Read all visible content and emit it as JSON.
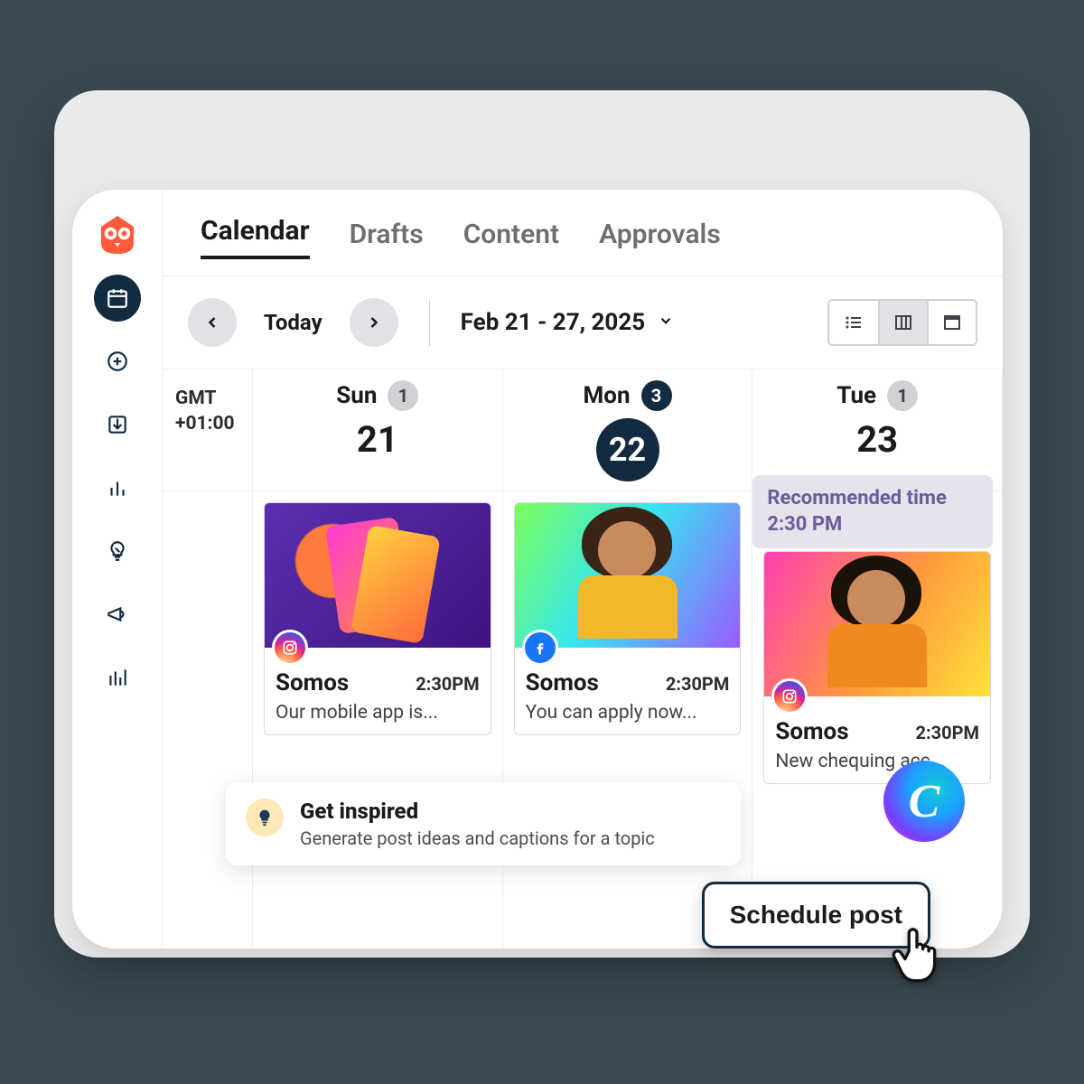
{
  "tabs": {
    "calendar": "Calendar",
    "drafts": "Drafts",
    "content": "Content",
    "approvals": "Approvals"
  },
  "toolbar": {
    "today": "Today",
    "date_range": "Feb 21 - 27, 2025"
  },
  "timezone": {
    "l1": "GMT",
    "l2": "+01:00"
  },
  "days": {
    "sun": {
      "name": "Sun",
      "num": "21",
      "count": "1"
    },
    "mon": {
      "name": "Mon",
      "num": "22",
      "count": "3"
    },
    "tue": {
      "name": "Tue",
      "num": "23",
      "count": "1"
    }
  },
  "posts": {
    "p1": {
      "name": "Somos",
      "time": "2:30PM",
      "caption": "Our mobile app is...",
      "social": "instagram"
    },
    "p2": {
      "name": "Somos",
      "time": "2:30PM",
      "caption": "You can apply now...",
      "social": "facebook"
    },
    "p3": {
      "name": "Somos",
      "time": "2:30PM",
      "caption": "New chequing acc...",
      "social": "instagram"
    }
  },
  "tooltip": {
    "l1": "Recommended time",
    "l2": "2:30 PM"
  },
  "inspire": {
    "title": "Get inspired",
    "sub": "Generate post ideas and captions for a topic"
  },
  "canva": {
    "letter": "C"
  },
  "schedule": {
    "label": "Schedule post"
  },
  "sidebar_icons": [
    "calendar",
    "plus",
    "inbox",
    "analytics",
    "lightbulb",
    "megaphone",
    "bars"
  ]
}
